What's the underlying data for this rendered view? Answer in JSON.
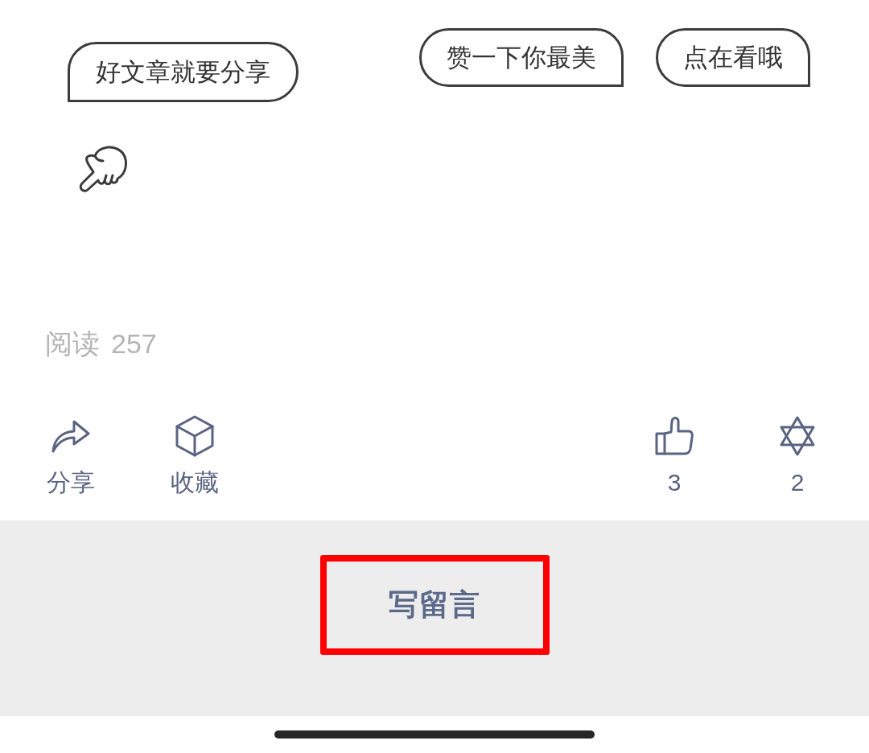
{
  "bubbles": [
    {
      "text": "好文章就要分享",
      "kind": "left"
    },
    {
      "text": "赞一下你最美",
      "kind": "right"
    },
    {
      "text": "点在看哦",
      "kind": "right"
    }
  ],
  "read_count": {
    "label": "阅读",
    "count": "257"
  },
  "actions": [
    {
      "kind": "share",
      "label": "分享"
    },
    {
      "kind": "favorite",
      "label": "收藏"
    },
    {
      "kind": "like",
      "label": "3"
    },
    {
      "kind": "wow",
      "label": "2"
    }
  ],
  "comment_button": {
    "label": "写留言",
    "highlighted": true
  }
}
